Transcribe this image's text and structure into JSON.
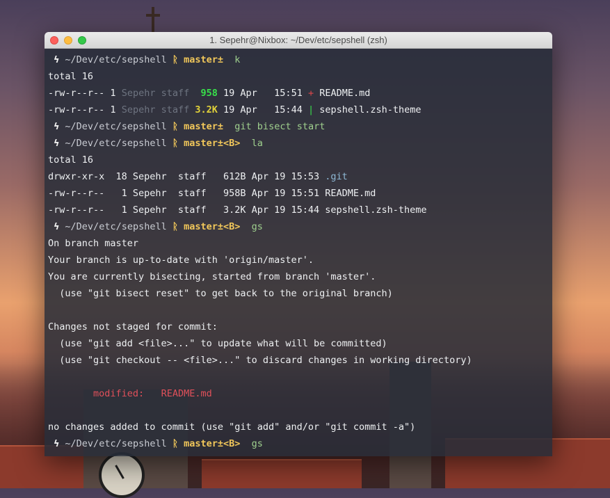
{
  "window": {
    "title": "1. Sepehr@Nixbox: ~/Dev/etc/sepshell (zsh)"
  },
  "prompt": {
    "bolt": "ϟ",
    "path": "~/Dev/etc/sepshell",
    "branch_icon": "ᚱ"
  },
  "lines": {
    "p1": {
      "branch": "master±",
      "cmd": "k"
    },
    "total1": "total 16",
    "k1": {
      "perm": "-rw-r--r-- 1",
      "owner": "Sepehr staff",
      "size": "958",
      "date": "19 Apr   15:51",
      "marker": "+",
      "name": "README.md"
    },
    "k2": {
      "perm": "-rw-r--r-- 1",
      "owner": "Sepehr staff",
      "size": "3.2K",
      "date": "19 Apr   15:44",
      "marker": "|",
      "name": "sepshell.zsh-theme"
    },
    "p2": {
      "branch": "master±",
      "cmd": "git bisect start"
    },
    "p3": {
      "branch": "master±<B>",
      "cmd": "la"
    },
    "total2": "total 16",
    "la1": {
      "text": "drwxr-xr-x  18 Sepehr  staff   612B Apr 19 15:53 ",
      "name": ".git"
    },
    "la2": "-rw-r--r--   1 Sepehr  staff   958B Apr 19 15:51 README.md",
    "la3": "-rw-r--r--   1 Sepehr  staff   3.2K Apr 19 15:44 sepshell.zsh-theme",
    "p4": {
      "branch": "master±<B>",
      "cmd": "gs"
    },
    "gs1": "On branch master",
    "gs2": "Your branch is up-to-date with 'origin/master'.",
    "gs3": "You are currently bisecting, started from branch 'master'.",
    "gs4": "  (use \"git bisect reset\" to get back to the original branch)",
    "gs5": "Changes not staged for commit:",
    "gs6": "  (use \"git add <file>...\" to update what will be committed)",
    "gs7": "  (use \"git checkout -- <file>...\" to discard changes in working directory)",
    "gs8": {
      "label": "        modified:   ",
      "file": "README.md"
    },
    "gs9": "no changes added to commit (use \"git add\" and/or \"git commit -a\")",
    "p5": {
      "branch": "master±<B>",
      "cmd": "gs"
    }
  }
}
